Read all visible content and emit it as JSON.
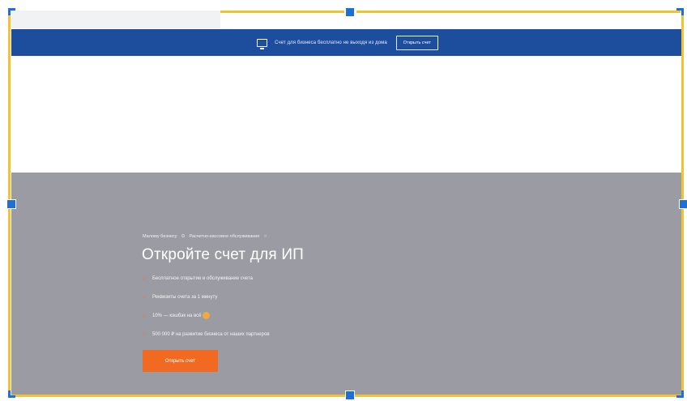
{
  "promo": {
    "text": "Счет для бизнеса бесплатно не выходя из дома",
    "button_label": "Открыть счет",
    "icon": "monitor-icon"
  },
  "hero": {
    "breadcrumbs": [
      "Малому бизнесу",
      "Расчетно-кассовое обслуживание"
    ],
    "title": "Откройте счет для ИП",
    "features": [
      "Бесплатное открытие и обслуживание счета",
      "Реквизиты счета за 1 минуту",
      "10% — кэшбэк на всё",
      "500 000 ₽ на развитие бизнеса от наших партнеров"
    ],
    "cta_label": "Открыть счет"
  },
  "colors": {
    "banner": "#1d4e9e",
    "hero_bg": "#9b9ca3",
    "accent": "#f26a21",
    "selection": "#f2c230",
    "handle": "#1f6fd9"
  }
}
